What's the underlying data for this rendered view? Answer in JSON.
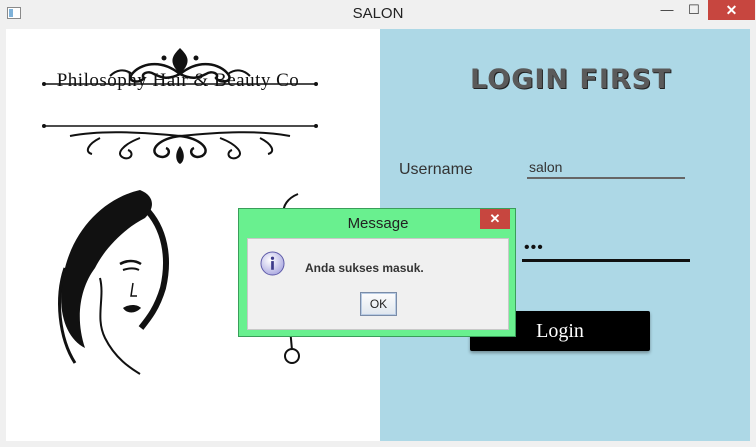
{
  "window": {
    "title": "SALON",
    "minimize": "—",
    "maximize": "☐",
    "close": "✕"
  },
  "brand": {
    "name": "Philosophy Hair & Beauty Co"
  },
  "login": {
    "title": "LOGIN FIRST",
    "username_label": "Username",
    "username_value": "salon",
    "password_value": "•••",
    "button_label": "Login"
  },
  "dialog": {
    "title": "Message",
    "close": "✕",
    "message": "Anda sukses masuk.",
    "ok_label": "OK"
  },
  "colors": {
    "right_panel": "#add8e6",
    "dialog_frame": "#69f08f",
    "close_button": "#c7463f"
  }
}
